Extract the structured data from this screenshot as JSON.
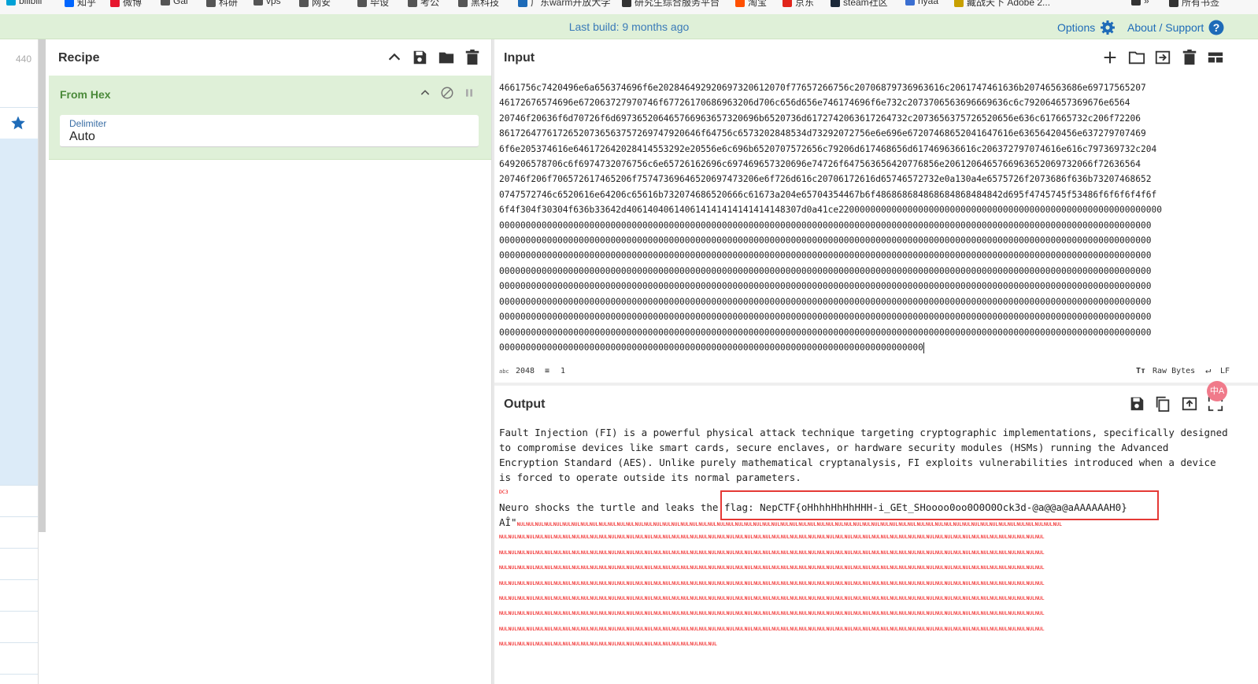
{
  "bookmarks": [
    {
      "label": "bilibili",
      "color": "#00a1d6"
    },
    {
      "label": "知乎",
      "color": "#0066ff"
    },
    {
      "label": "微博",
      "color": "#e6162d"
    },
    {
      "label": "Gal",
      "color": "#555555"
    },
    {
      "label": "科研",
      "color": "#555555"
    },
    {
      "label": "vps",
      "color": "#555555"
    },
    {
      "label": "网安",
      "color": "#555555"
    },
    {
      "label": "毕设",
      "color": "#555555"
    },
    {
      "label": "考公",
      "color": "#555555"
    },
    {
      "label": "黑科技",
      "color": "#555555"
    },
    {
      "label": "广东warm开放大学",
      "color": "#1e6bb8"
    },
    {
      "label": "研究生综合服务平台",
      "color": "#333333"
    },
    {
      "label": "淘宝",
      "color": "#ff5000"
    },
    {
      "label": "京东",
      "color": "#e1251b"
    },
    {
      "label": "steam社区",
      "color": "#1b2838"
    },
    {
      "label": "nyaa",
      "color": "#3b6fd1"
    },
    {
      "label": "藏战天下 Adobe 2...",
      "color": "#c8a000"
    },
    {
      "label": "»",
      "color": "#333333"
    },
    {
      "label": "所有书签",
      "color": "#333333"
    }
  ],
  "banner": {
    "build": "Last build: 9 months ago",
    "options": "Options",
    "about": "About / Support"
  },
  "operations": {
    "count": "440"
  },
  "recipe": {
    "title": "Recipe",
    "operation": {
      "name": "From Hex",
      "arg_label": "Delimiter",
      "arg_value": "Auto"
    }
  },
  "input": {
    "title": "Input",
    "lines": [
      "4661756c7420496e6a656374696f6e202846492920697320612070f77657266756c20706879736963616c2061747461636b20746563686e69717565207",
      "46172676574696e672063727970746f67726170686963206d706c656d656e746174696f6e732c2073706563696669636c6c792064657369676e6564",
      "20746f20636f6d70726f6d697365206465766963657320696b6520736d6172742063617264732c2073656375726520656e636c617665732c206f72206",
      "86172647761726520736563757269747920646f64756c6573202848534d73292072756e6e696e67207468652041647616e63656420456e637279707469",
      "6f6e205374616e646172642028414553292e20556e6c696b6520707572656c79206d617468656d617469636616c206372797074616e616c797369732c204",
      "649206578706c6f6974732076756c6e65726162696c697469657320696e74726f647563656420776856e2061206465766963652069732066f72636564",
      "20746f206f706572617465206f75747369646520697473206e6f726d616c20706172616d65746572732e0a130a4e6575726f2073686f636b73207468652",
      "0747572746c6520616e64206c65616b732074686520666c61673a204e65704354467b6f486868684868684868484842d695f4745745f53486f6f6f6f4f6f",
      "6f4f304f30304f636b33642d406140406140614141414141414148307d0a41ce2200000000000000000000000000000000000000000000000000000000000",
      "000000000000000000000000000000000000000000000000000000000000000000000000000000000000000000000000000000000000000000000000000",
      "000000000000000000000000000000000000000000000000000000000000000000000000000000000000000000000000000000000000000000000000000",
      "000000000000000000000000000000000000000000000000000000000000000000000000000000000000000000000000000000000000000000000000000",
      "000000000000000000000000000000000000000000000000000000000000000000000000000000000000000000000000000000000000000000000000000",
      "000000000000000000000000000000000000000000000000000000000000000000000000000000000000000000000000000000000000000000000000000",
      "000000000000000000000000000000000000000000000000000000000000000000000000000000000000000000000000000000000000000000000000000",
      "000000000000000000000000000000000000000000000000000000000000000000000000000000000000000000000000000000000000000000000000000",
      "000000000000000000000000000000000000000000000000000000000000000000000000000000000000000000000000000000000000000000000000000",
      "00000000000000000000000000000000000000000000000000000000000000000000000000000000"
    ],
    "status": {
      "length": "2048",
      "lines": "1",
      "encoding": "Raw Bytes",
      "eol": "LF"
    }
  },
  "output": {
    "title": "Output",
    "paragraph": "Fault Injection (FI) is a powerful physical attack technique targeting cryptographic implementations, specifically designed to compromise devices like smart cards, secure enclaves, or hardware security modules (HSMs) running the Advanced Encryption Standard (AES). Unlike purely mathematical cryptanalysis, FI exploits vulnerabilities introduced when a device is forced to operate outside its normal parameters.",
    "ctrl": "DC3",
    "flag_line_prefix": "Neuro shocks the turtle and leaks the ",
    "flag_text": "flag: NepCTF{oHhhhHhHhHHH-i_GEt_SHoooo0oo0O0O0Ock3d-@a@@a@aAAAAAAH0}",
    "tail_prefix": "AÎ\"",
    "nul_token": "NUL",
    "nul_lines": 8,
    "nul_last": 24
  },
  "badge": "中A"
}
